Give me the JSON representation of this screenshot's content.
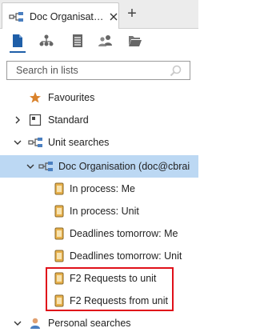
{
  "tab": {
    "title": "Doc Organisation",
    "new_tab_symbol": "+"
  },
  "toolbar": {
    "buttons": [
      {
        "icon": "document-icon",
        "active": true
      },
      {
        "icon": "hierarchy-icon",
        "active": false
      },
      {
        "icon": "list-icon",
        "active": false
      },
      {
        "icon": "users-icon",
        "active": false
      },
      {
        "icon": "folder-icon",
        "active": false
      }
    ]
  },
  "search": {
    "placeholder": "Search in lists"
  },
  "tree": {
    "favourites": "Favourites",
    "standard": "Standard",
    "unit_searches": "Unit searches",
    "doc_org": "Doc Organisation (doc@cbrai",
    "items": [
      "In process: Me",
      "In process: Unit",
      "Deadlines tomorrow: Me",
      "Deadlines tomorrow: Unit",
      "F2 Requests to unit",
      "F2 Requests from unit"
    ],
    "personal_searches": "Personal searches"
  },
  "colors": {
    "accent": "#1f5fa8",
    "selected_row": "#bcd8f3",
    "highlight_box": "#e0101a",
    "star": "#d9822b"
  }
}
